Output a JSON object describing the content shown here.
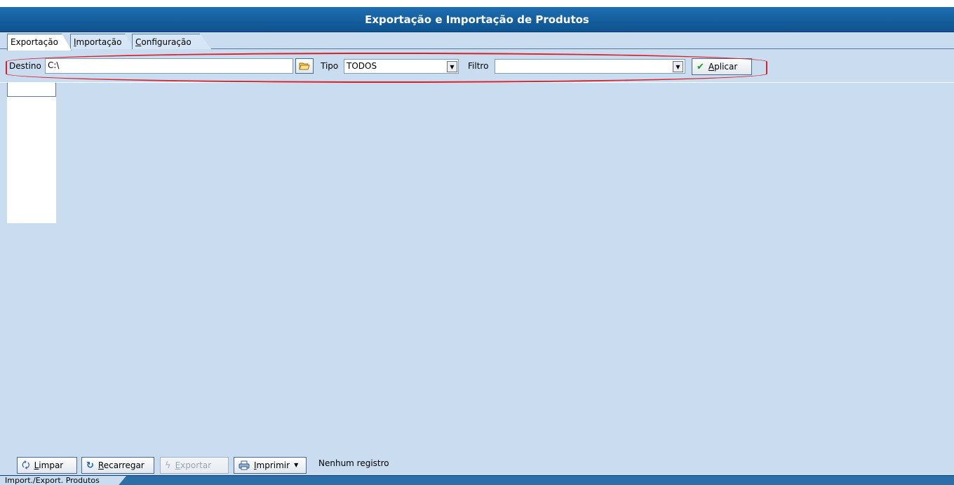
{
  "window": {
    "title": "Exportação e Importação de Produtos"
  },
  "tabs": [
    {
      "label": "Exportação",
      "active": true
    },
    {
      "label_first": "I",
      "label_rest": "mportação",
      "active": false
    },
    {
      "label_first": "C",
      "label_rest": "onfiguração",
      "active": false
    }
  ],
  "toolbar": {
    "destino_label": "Destino",
    "destino_value": "C:\\",
    "tipo_label": "Tipo",
    "tipo_value": "TODOS",
    "filtro_label": "Filtro",
    "filtro_value": "",
    "aplicar_first": "A",
    "aplicar_rest": "plicar"
  },
  "footer": {
    "limpar_first": "L",
    "limpar_rest": "impar",
    "recarregar_first": "R",
    "recarregar_rest": "ecarregar",
    "exportar_first": "E",
    "exportar_rest": "xportar",
    "imprimir_first": "I",
    "imprimir_rest": "mprimir",
    "status": "Nenhum registro"
  },
  "statusbar": {
    "tab_label": "Import./Export. Produtos"
  },
  "colors": {
    "title_bg": "#135d9c",
    "body_bg": "#c9dcf0",
    "highlight": "#d6202a"
  }
}
